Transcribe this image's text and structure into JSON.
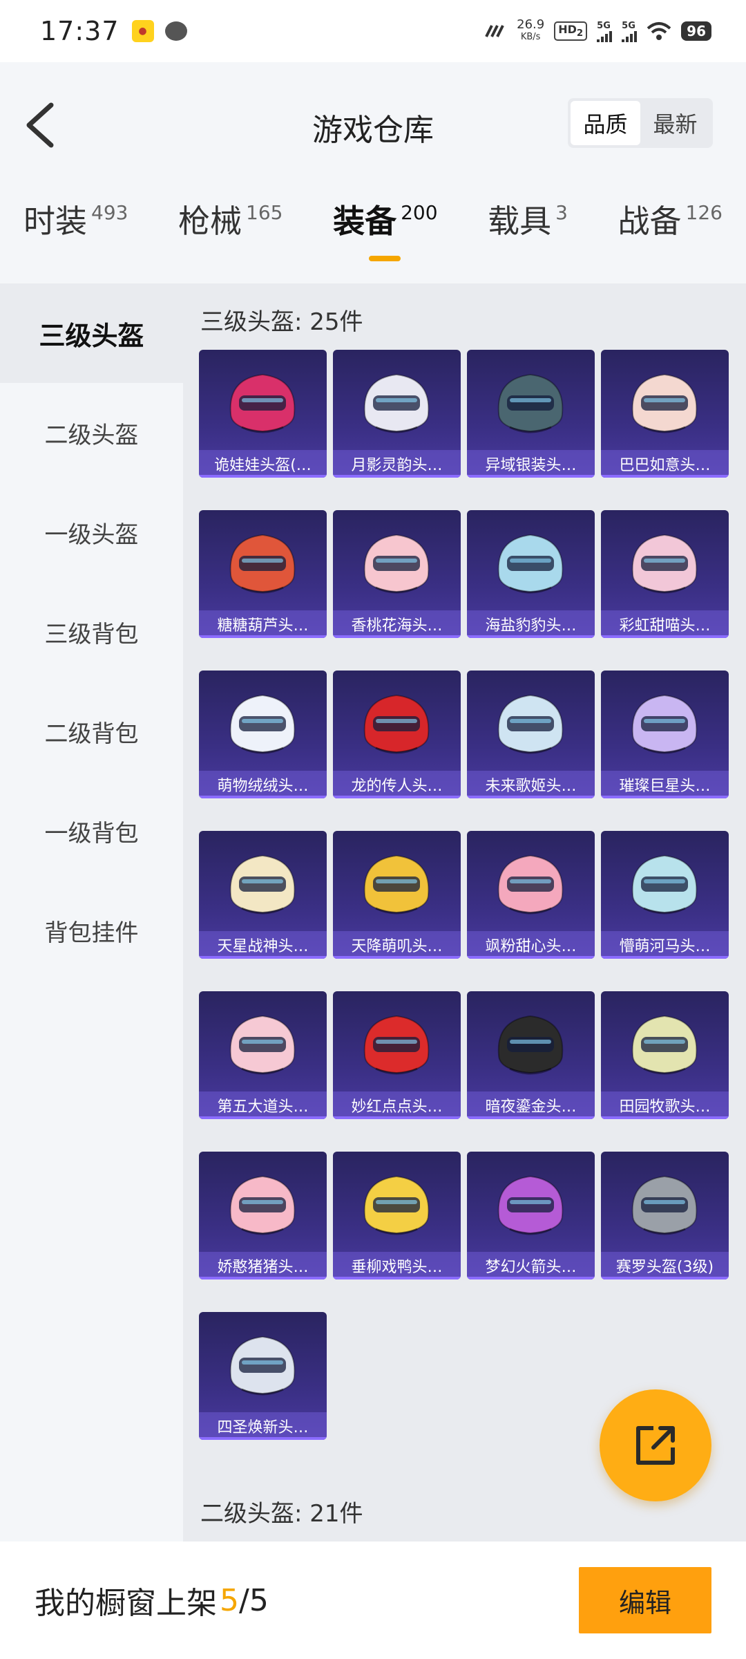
{
  "status_bar": {
    "time": "17:37",
    "speed_value": "26.9",
    "speed_unit": "KB/s",
    "hd_label": "HD",
    "hd_sub": "2",
    "net1": "5G",
    "net2": "5G",
    "battery": "96"
  },
  "header": {
    "title": "游戏仓库",
    "sort_options": [
      "品质",
      "最新"
    ],
    "sort_selected": "品质"
  },
  "tabs": [
    {
      "label": "时装",
      "count": "493"
    },
    {
      "label": "枪械",
      "count": "165"
    },
    {
      "label": "装备",
      "count": "200"
    },
    {
      "label": "载具",
      "count": "3"
    },
    {
      "label": "战备",
      "count": "126"
    }
  ],
  "active_tab": "装备",
  "sidebar": {
    "items": [
      "三级头盔",
      "二级头盔",
      "一级头盔",
      "三级背包",
      "二级背包",
      "一级背包",
      "背包挂件"
    ],
    "active": "三级头盔"
  },
  "sections": [
    {
      "title": "三级头盔: 25件",
      "items": [
        {
          "name": "诡娃娃头盔(…",
          "color": "#d9306a"
        },
        {
          "name": "月影灵韵头…",
          "color": "#e8e8f2"
        },
        {
          "name": "异域银装头…",
          "color": "#4a6670"
        },
        {
          "name": "巴巴如意头…",
          "color": "#f4d8d0"
        },
        {
          "name": "糖糖葫芦头…",
          "color": "#e0563a"
        },
        {
          "name": "香桃花海头…",
          "color": "#f7c6cf"
        },
        {
          "name": "海盐豹豹头…",
          "color": "#a9d9ec"
        },
        {
          "name": "彩虹甜喵头…",
          "color": "#f2c7d8"
        },
        {
          "name": "萌物绒绒头…",
          "color": "#eef2fa"
        },
        {
          "name": "龙的传人头…",
          "color": "#d7262a"
        },
        {
          "name": "未来歌姬头…",
          "color": "#cfe4f2"
        },
        {
          "name": "璀璨巨星头…",
          "color": "#c9b6f2"
        },
        {
          "name": "天星战神头…",
          "color": "#f3e7c4"
        },
        {
          "name": "天降萌叽头…",
          "color": "#f1c23a"
        },
        {
          "name": "飒粉甜心头…",
          "color": "#f4a8bd"
        },
        {
          "name": "懵萌河马头…",
          "color": "#b8e2ec"
        },
        {
          "name": "第五大道头…",
          "color": "#f6c9d4"
        },
        {
          "name": "妙红点点头…",
          "color": "#dc2b2b"
        },
        {
          "name": "暗夜鎏金头…",
          "color": "#2b2b2b"
        },
        {
          "name": "田园牧歌头…",
          "color": "#e3e4b0"
        },
        {
          "name": "娇憨猪猪头…",
          "color": "#f7b9c8"
        },
        {
          "name": "垂柳戏鸭头…",
          "color": "#f4cf44"
        },
        {
          "name": "梦幻火箭头…",
          "color": "#b55bd6"
        },
        {
          "name": "赛罗头盔(3级)",
          "color": "#9aa0a8"
        },
        {
          "name": "四圣焕新头…",
          "color": "#dde3ee"
        }
      ]
    },
    {
      "title": "二级头盔: 21件"
    }
  ],
  "bottom_bar": {
    "label": "我的橱窗上架",
    "count": "5",
    "total": "/5",
    "edit_label": "编辑"
  },
  "icons": {
    "back": "chevron-left-icon",
    "share": "share-external-icon"
  },
  "accent_color": "#f5a600"
}
